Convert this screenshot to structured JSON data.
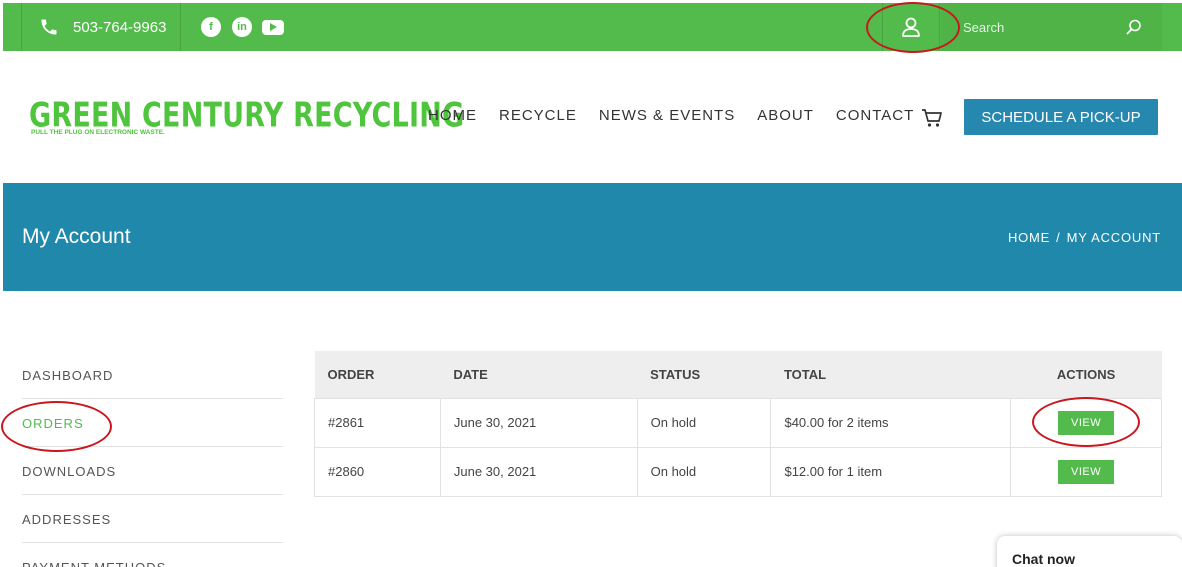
{
  "topbar": {
    "phone": "503-764-9963",
    "social": [
      {
        "icon": "facebook-icon",
        "glyph": "f"
      },
      {
        "icon": "linkedin-icon",
        "glyph": "in"
      },
      {
        "icon": "youtube-icon",
        "glyph": ""
      }
    ],
    "search_placeholder": "Search",
    "color": "#52bb4b"
  },
  "logo": {
    "title": "GREEN CENTURY RECYCLING",
    "tagline": "PULL THE PLUG ON ELECTRONIC WASTE."
  },
  "nav": {
    "items": [
      "HOME",
      "RECYCLE",
      "NEWS & EVENTS",
      "ABOUT",
      "CONTACT"
    ],
    "cta": "SCHEDULE A PICK-UP"
  },
  "banner": {
    "title": "My Account",
    "breadcrumb": {
      "home": "HOME",
      "sep": "/",
      "current": "MY ACCOUNT"
    },
    "color": "#2088ab"
  },
  "sidebar": {
    "items": [
      "DASHBOARD",
      "ORDERS",
      "DOWNLOADS",
      "ADDRESSES",
      "PAYMENT METHODS"
    ]
  },
  "orders": {
    "headers": [
      "ORDER",
      "DATE",
      "STATUS",
      "TOTAL",
      "ACTIONS"
    ],
    "rows": [
      {
        "order": "#2861",
        "date": "June 30, 2021",
        "status": "On hold",
        "total": "$40.00 for 2 items",
        "action": "VIEW"
      },
      {
        "order": "#2860",
        "date": "June 30, 2021",
        "status": "On hold",
        "total": "$12.00 for 1 item",
        "action": "VIEW"
      }
    ]
  },
  "chat": {
    "label": "Chat now"
  }
}
